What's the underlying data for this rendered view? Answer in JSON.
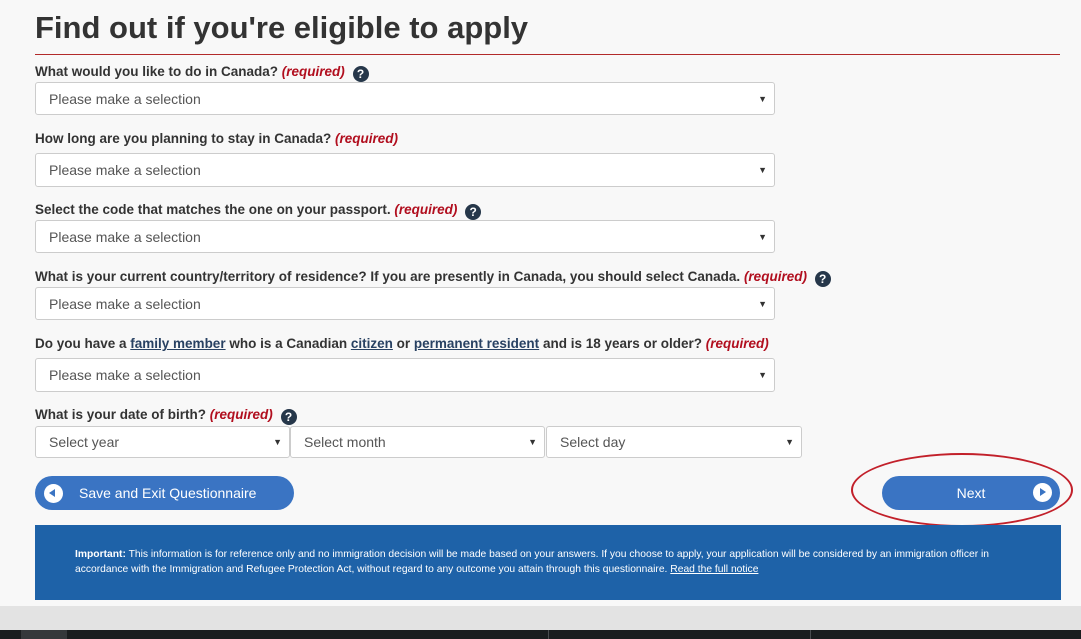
{
  "page": {
    "title": "Find out if you're eligible to apply"
  },
  "questions": {
    "q1": {
      "label": "What would you like to do in Canada?",
      "required": "(required)",
      "select": "Please make a selection"
    },
    "q2": {
      "label": "How long are you planning to stay in Canada?",
      "required": "(required)",
      "select": "Please make a selection"
    },
    "q3": {
      "label": "Select the code that matches the one on your passport.",
      "required": "(required)",
      "select": "Please make a selection"
    },
    "q4": {
      "label": "What is your current country/territory of residence? If you are presently in Canada, you should select Canada.",
      "required": "(required)",
      "select": "Please make a selection"
    },
    "q5": {
      "part1": "Do you have a ",
      "link1": "family member",
      "part2": " who is a Canadian ",
      "link2": "citizen",
      "part3": " or ",
      "link3": "permanent resident",
      "part4": " and is 18 years or older?",
      "required": "(required)",
      "select": "Please make a selection"
    },
    "q6": {
      "label": "What is your date of birth?",
      "required": "(required)",
      "year": "Select year",
      "month": "Select month",
      "day": "Select day"
    }
  },
  "icons": {
    "help": "help-question-icon",
    "arrow": "dropdown-arrow-icon",
    "back": "circle-left-arrow-icon",
    "forward": "circle-right-arrow-icon"
  },
  "help_glyph": "?",
  "arrow_glyph": "▼",
  "buttons": {
    "save_exit": "Save and Exit Questionnaire",
    "next": "Next"
  },
  "notice": {
    "important": "Important:",
    "text": " This information is for reference only and no immigration decision will be made based on your answers. If you choose to apply, your application will be considered by an immigration officer in accordance with the Immigration and Refugee Protection Act, without regard to any outcome you attain through this questionnaire. ",
    "link": "Read the full notice"
  },
  "colors": {
    "button": "#3a74c3",
    "notice_bg": "#1e62a8",
    "required": "#b10e1e",
    "highlight_oval": "#c2202a"
  }
}
